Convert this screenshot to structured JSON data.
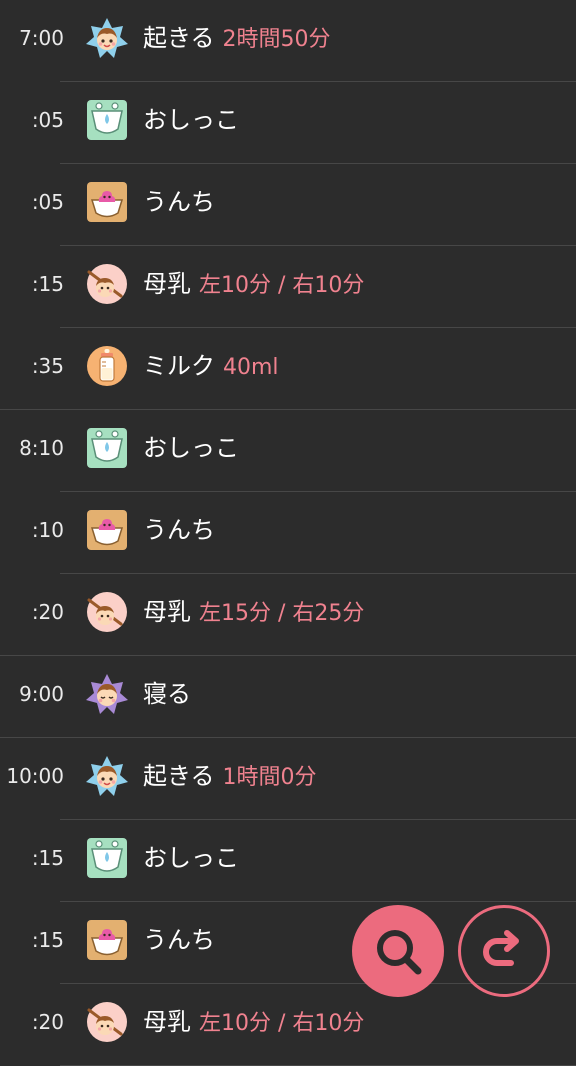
{
  "colors": {
    "background": "#2c2c2c",
    "divider": "#474747",
    "accent": "#ec6b7e",
    "detail_text": "#f0828f"
  },
  "log": [
    {
      "time": "7:00",
      "icon": "wake-star-icon",
      "label": "起きる",
      "detail": "2時間50分",
      "full_divider": false
    },
    {
      "time": ":05",
      "icon": "diaper-pee-icon",
      "label": "おしっこ",
      "detail": "",
      "full_divider": false
    },
    {
      "time": ":05",
      "icon": "diaper-poop-icon",
      "label": "うんち",
      "detail": "",
      "full_divider": false
    },
    {
      "time": ":15",
      "icon": "breastfeed-icon",
      "label": "母乳",
      "detail": "左10分 / 右10分",
      "full_divider": false
    },
    {
      "time": ":35",
      "icon": "milk-bottle-icon",
      "label": "ミルク",
      "detail": "40ml",
      "full_divider": true
    },
    {
      "time": "8:10",
      "icon": "diaper-pee-icon",
      "label": "おしっこ",
      "detail": "",
      "full_divider": false
    },
    {
      "time": ":10",
      "icon": "diaper-poop-icon",
      "label": "うんち",
      "detail": "",
      "full_divider": false
    },
    {
      "time": ":20",
      "icon": "breastfeed-icon",
      "label": "母乳",
      "detail": "左15分 / 右25分",
      "full_divider": true
    },
    {
      "time": "9:00",
      "icon": "sleep-star-icon",
      "label": "寝る",
      "detail": "",
      "full_divider": true
    },
    {
      "time": "10:00",
      "icon": "wake-star-icon",
      "label": "起きる",
      "detail": "1時間0分",
      "full_divider": false
    },
    {
      "time": ":15",
      "icon": "diaper-pee-icon",
      "label": "おしっこ",
      "detail": "",
      "full_divider": false
    },
    {
      "time": ":15",
      "icon": "diaper-poop-icon",
      "label": "うんち",
      "detail": "",
      "full_divider": false
    },
    {
      "time": ":20",
      "icon": "breastfeed-icon",
      "label": "母乳",
      "detail": "左10分 / 右10分",
      "full_divider": false
    }
  ],
  "buttons": {
    "search": {
      "icon": "search-icon"
    },
    "return": {
      "icon": "return-arrow-icon"
    }
  }
}
